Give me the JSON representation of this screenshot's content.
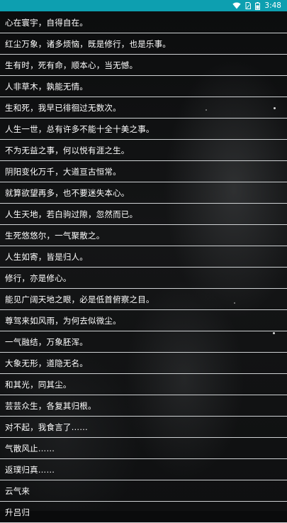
{
  "status_bar": {
    "time": "3:48",
    "background": "#0d9fb0",
    "icons": [
      "wifi-icon",
      "sim-icon",
      "battery-icon"
    ]
  },
  "list_items": [
    "心在寰宇，自得自在。",
    "红尘万象，诸多烦恼，既是修行，也是乐事。",
    "生有时，死有命，顺本心，当无憾。",
    "人非草木，孰能无情。",
    "生和死，我早已徘徊过无数次。",
    "人生一世，总有许多不能十全十美之事。",
    "不为无益之事，何以悦有涯之生。",
    "阴阳变化万千，大道亘古恒常。",
    "就算欲望再多，也不要迷失本心。",
    "人生天地，若白驹过隙，忽然而已。",
    "生死悠悠尔，一气聚散之。",
    "人生如寄，皆是归人。",
    "修行，亦是修心。",
    "能见广阔天地之眼，必是低首俯察之目。",
    "尊驾来如风雨，为何去似微尘。",
    "一气融结，万象胚浑。",
    "大象无形，道隐无名。",
    "和其光，同其尘。",
    "芸芸众生，各复其归根。",
    "对不起，我食言了……",
    "气散风止……",
    "返璞归真……",
    "云气来",
    "升吕归"
  ]
}
